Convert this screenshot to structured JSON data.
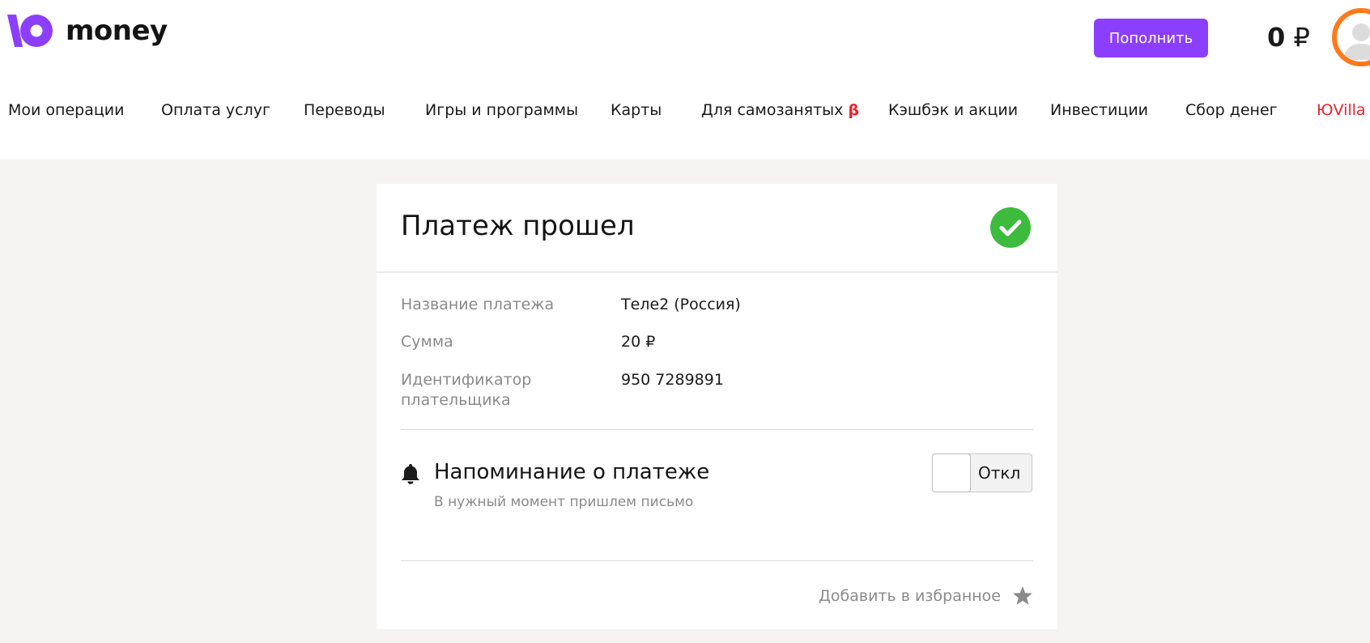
{
  "header": {
    "logo_text": "money",
    "topup_label": "Пополнить",
    "balance_amount": "0",
    "balance_currency": "₽",
    "brand_color": "#8b3ffd",
    "avatar_ring_color": "#ff7a1a"
  },
  "nav": {
    "items": [
      {
        "label": "Мои операции"
      },
      {
        "label": "Оплата услуг"
      },
      {
        "label": "Переводы"
      },
      {
        "label": "Игры и программы"
      },
      {
        "label": "Карты"
      },
      {
        "label": "Для самозанятых",
        "badge": "β"
      },
      {
        "label": "Кэшбэк и акции"
      },
      {
        "label": "Инвестиции"
      },
      {
        "label": "Сбор денег"
      },
      {
        "label": "ЮVilla"
      }
    ]
  },
  "card": {
    "title": "Платеж прошел",
    "status_icon": "check-circle-icon",
    "status_color": "#3dbb3d",
    "details": [
      {
        "label": "Название платежа",
        "value": "Теле2 (Россия)"
      },
      {
        "label": "Сумма",
        "value": "20 ₽"
      },
      {
        "label": "Идентификатор плательщика",
        "value": "950 7289891"
      }
    ],
    "reminder": {
      "title": "Напоминание о платеже",
      "subtitle": "В нужный момент пришлем письмо",
      "toggle_label": "Откл",
      "icon": "bell-icon"
    },
    "favorite": {
      "label": "Добавить в избранное",
      "icon": "star-icon"
    }
  }
}
